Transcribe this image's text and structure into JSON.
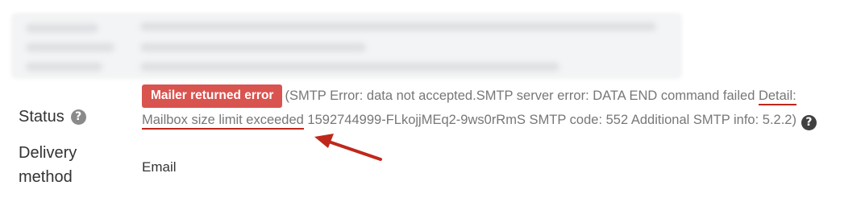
{
  "status": {
    "label": "Status",
    "badge": "Mailer returned error",
    "message_pre": "(SMTP Error: data not accepted.SMTP server error: DATA END command failed ",
    "message_highlight": "Detail: Mailbox size limit exceeded",
    "message_post": " 1592744999-FLkojjMEq2-9ws0rRmS SMTP code: 552 Additional SMTP info: 5.2.2)",
    "help_icon": "question-circle-icon"
  },
  "delivery": {
    "label": "Delivery method",
    "value": "Email"
  },
  "colors": {
    "badge": "#d9534f",
    "annotation": "#c0271b",
    "muted_text": "#777777"
  }
}
